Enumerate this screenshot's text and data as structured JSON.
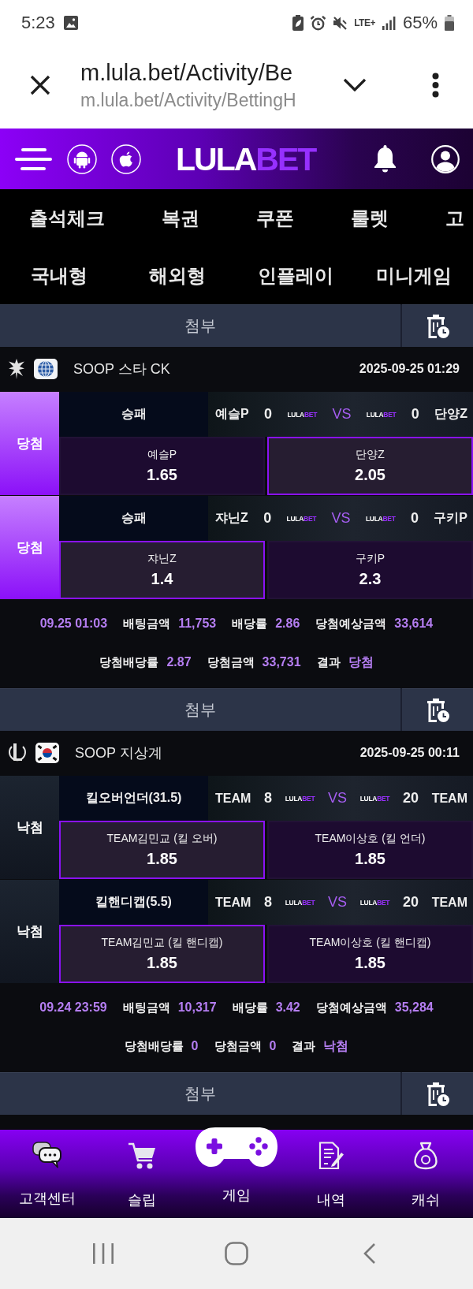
{
  "status_bar": {
    "time": "5:23",
    "network": "LTE+",
    "battery": "65%"
  },
  "browser": {
    "title": "m.lula.bet/Activity/Be",
    "url": "m.lula.bet/Activity/BettingH"
  },
  "header": {
    "logo": {
      "main": "LULA",
      "accent": "BET"
    }
  },
  "menu_primary": [
    "출석체크",
    "복권",
    "쿠폰",
    "룰렛",
    "고"
  ],
  "menu_secondary": [
    "국내형",
    "해외형",
    "인플레이",
    "미니게임"
  ],
  "slips": [
    {
      "attach_label": "첨부",
      "emblem": {
        "kind": "starcraft"
      },
      "flag": {
        "kind": "globe"
      },
      "league": "SOOP 스타 CK",
      "datetime": "2025-09-25 01:29",
      "selections": [
        {
          "result": "당첨",
          "won": true,
          "market": "승패",
          "home": {
            "name": "예슬P",
            "score": "0",
            "logo": {
              "main": "LULA",
              "accent": "BET"
            }
          },
          "vs": "VS",
          "away": {
            "name": "단양Z",
            "score": "0",
            "logo": {
              "main": "LULA",
              "accent": "BET"
            }
          },
          "options": [
            {
              "name": "예슬P",
              "odds": "1.65",
              "selected": false
            },
            {
              "name": "단양Z",
              "odds": "2.05",
              "selected": true
            }
          ]
        },
        {
          "result": "당첨",
          "won": true,
          "market": "승패",
          "home": {
            "name": "쟈닌Z",
            "score": "0",
            "logo": {
              "main": "LULA",
              "accent": "BET"
            }
          },
          "vs": "VS",
          "away": {
            "name": "구키P",
            "score": "0",
            "logo": {
              "main": "LULA",
              "accent": "BET"
            }
          },
          "options": [
            {
              "name": "쟈닌Z",
              "odds": "1.4",
              "selected": true
            },
            {
              "name": "구키P",
              "odds": "2.3",
              "selected": false
            }
          ]
        }
      ],
      "summary": [
        [
          {
            "value": "09.25 01:03"
          },
          {
            "label": "배팅금액",
            "value": "11,753"
          },
          {
            "label": "배당률",
            "value": "2.86"
          },
          {
            "label": "당첨예상금액",
            "value": "33,614"
          }
        ],
        [
          {
            "label": "당첨배당률",
            "value": "2.87"
          },
          {
            "label": "당첨금액",
            "value": "33,731"
          },
          {
            "label": "결과",
            "value": "당첨"
          }
        ]
      ]
    },
    {
      "attach_label": "첨부",
      "emblem": {
        "kind": "lol"
      },
      "flag": {
        "kind": "korea"
      },
      "league": "SOOP 지상계",
      "datetime": "2025-09-25 00:11",
      "selections": [
        {
          "result": "낙첨",
          "won": false,
          "market": "킬오버언더(31.5)",
          "home": {
            "name": "TEAM",
            "score": "8",
            "logo": {
              "main": "LULA",
              "accent": "BET"
            }
          },
          "vs": "VS",
          "away": {
            "name": "TEAM",
            "score": "20",
            "logo": {
              "main": "LULA",
              "accent": "BET"
            }
          },
          "options": [
            {
              "name": "TEAM김민교 (킬 오버)",
              "odds": "1.85",
              "selected": true
            },
            {
              "name": "TEAM이상호 (킬 언더)",
              "odds": "1.85",
              "selected": false
            }
          ]
        },
        {
          "result": "낙첨",
          "won": false,
          "market": "킬핸디캡(5.5)",
          "home": {
            "name": "TEAM",
            "score": "8",
            "logo": {
              "main": "LULA",
              "accent": "BET"
            }
          },
          "vs": "VS",
          "away": {
            "name": "TEAM",
            "score": "20",
            "logo": {
              "main": "LULA",
              "accent": "BET"
            }
          },
          "options": [
            {
              "name": "TEAM김민교 (킬 핸디캡)",
              "odds": "1.85",
              "selected": true
            },
            {
              "name": "TEAM이상호 (킬 핸디캡)",
              "odds": "1.85",
              "selected": false
            }
          ]
        }
      ],
      "summary": [
        [
          {
            "value": "09.24 23:59"
          },
          {
            "label": "배팅금액",
            "value": "10,317"
          },
          {
            "label": "배당률",
            "value": "3.42"
          },
          {
            "label": "당첨예상금액",
            "value": "35,284"
          }
        ],
        [
          {
            "label": "당첨배당률",
            "value": "0"
          },
          {
            "label": "당첨금액",
            "value": "0"
          },
          {
            "label": "결과",
            "value": "낙첨"
          }
        ]
      ]
    },
    {
      "attach_label": "첨부"
    }
  ],
  "bottom_nav": [
    {
      "kind": "chat",
      "label": "고객센터"
    },
    {
      "kind": "cart",
      "label": "슬립"
    },
    {
      "kind": "gamepad",
      "label": "게임"
    },
    {
      "kind": "document",
      "label": "내역"
    },
    {
      "kind": "moneybag",
      "label": "캐쉬"
    }
  ]
}
